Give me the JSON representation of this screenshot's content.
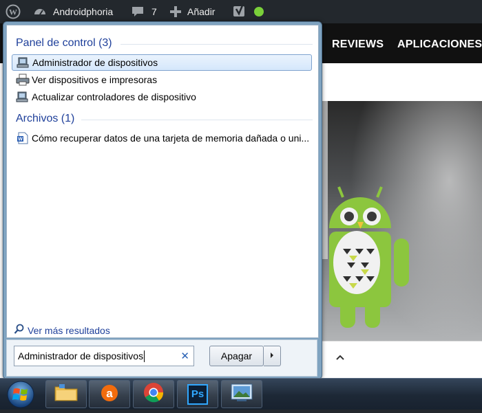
{
  "admin_bar": {
    "site_name": "Androidphoria",
    "comments_count": "7",
    "new_label": "Añadir",
    "icons": [
      "wordpress-icon",
      "dashboard-icon",
      "comment-icon",
      "plus-icon",
      "yoast-icon",
      "status-dot-icon"
    ],
    "status_color": "#7ad03a"
  },
  "site": {
    "nav": [
      "REVIEWS",
      "APLICACIONES"
    ]
  },
  "start_menu": {
    "sections": [
      {
        "title": "Panel de control (3)",
        "items": [
          {
            "label": "Administrador de dispositivos",
            "icon": "device-manager-icon",
            "selected": true
          },
          {
            "label": "Ver dispositivos e impresoras",
            "icon": "printer-icon",
            "selected": false
          },
          {
            "label": "Actualizar controladores de dispositivo",
            "icon": "device-manager-icon",
            "selected": false
          }
        ]
      },
      {
        "title": "Archivos (1)",
        "items": [
          {
            "label": "Cómo recuperar datos de una tarjeta de memoria dañada o uni...",
            "icon": "word-document-icon",
            "selected": false
          }
        ]
      }
    ],
    "more_results": "Ver más resultados",
    "search_value": "Administrador de dispositivos",
    "shutdown_label": "Apagar"
  },
  "taskbar": {
    "items": [
      "start-orb-icon",
      "file-explorer-icon",
      "avast-icon",
      "chrome-icon",
      "photoshop-icon",
      "photo-viewer-icon"
    ],
    "photoshop_label": "Ps"
  },
  "colors": {
    "section_header": "#1e3f9a",
    "admin_bar_bg": "#23282d",
    "android_green": "#8cc63e"
  }
}
